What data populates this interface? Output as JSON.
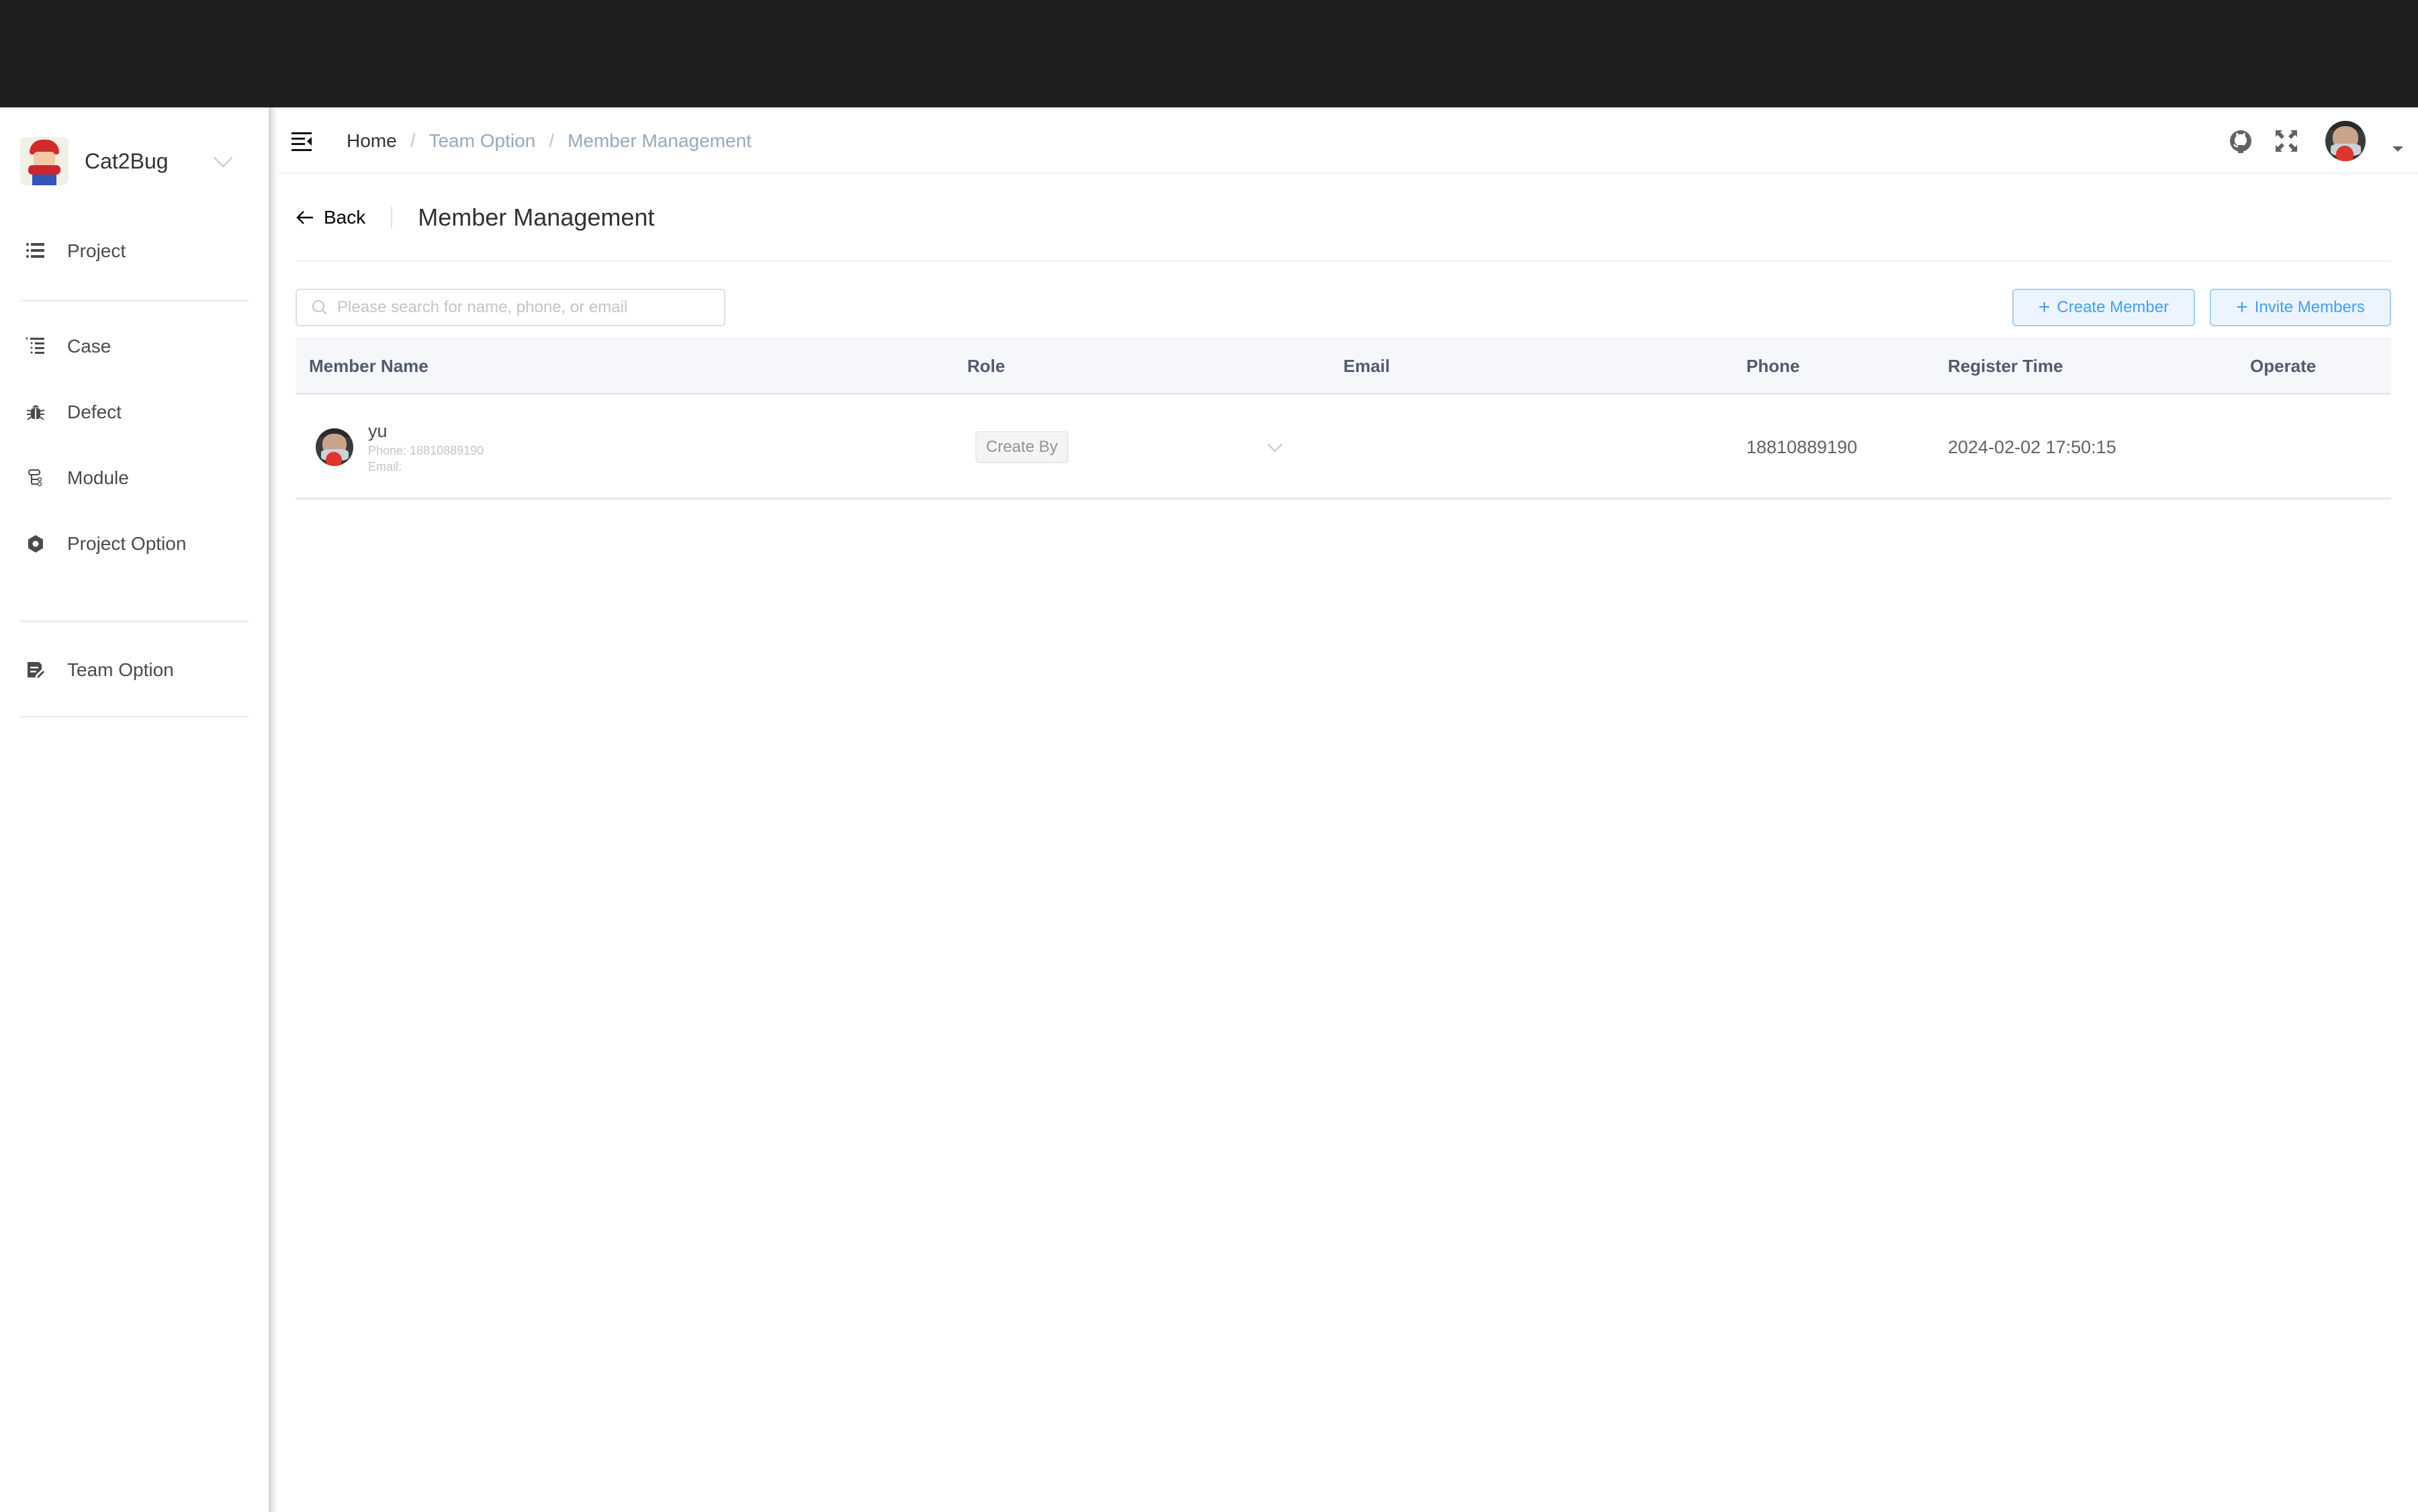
{
  "sidebar": {
    "brand_name": "Cat2Bug",
    "items": [
      {
        "label": "Project",
        "icon": "list-icon"
      },
      {
        "label": "Case",
        "icon": "list-tree-icon"
      },
      {
        "label": "Defect",
        "icon": "bug-icon"
      },
      {
        "label": "Module",
        "icon": "module-tree-icon"
      },
      {
        "label": "Project Option",
        "icon": "gear-icon"
      },
      {
        "label": "Team Option",
        "icon": "edit-document-icon"
      }
    ]
  },
  "header": {
    "breadcrumb": [
      {
        "label": "Home"
      },
      {
        "label": "Team Option"
      },
      {
        "label": "Member Management"
      }
    ],
    "separator": "/",
    "icons": [
      "github-icon",
      "fullscreen-icon"
    ]
  },
  "page": {
    "back_label": "Back",
    "title": "Member Management"
  },
  "toolbar": {
    "search_placeholder": "Please search for name, phone, or email",
    "search_value": "",
    "create_label": "Create Member",
    "invite_label": "Invite Members",
    "accent_color": "#409eff"
  },
  "table": {
    "columns": [
      "Member Name",
      "Role",
      "Email",
      "Phone",
      "Register Time",
      "Operate"
    ],
    "rows": [
      {
        "name": "yu",
        "sub_phone": "Phone: 18810889190",
        "sub_email": "Email:",
        "role": "Create By",
        "email": "",
        "phone": "18810889190",
        "register_time": "2024-02-02 17:50:15",
        "operate": ""
      }
    ]
  }
}
